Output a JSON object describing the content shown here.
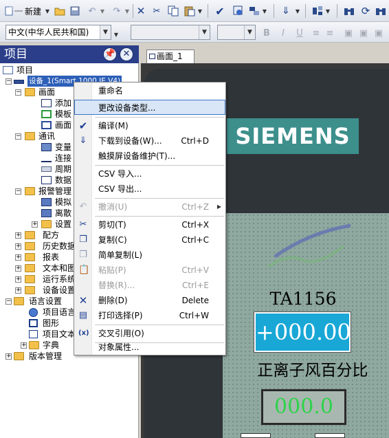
{
  "toolbar": {
    "new_label": "新建",
    "language_select": "中文(中华人民共和国)"
  },
  "left_pane": {
    "title": "项目",
    "tree": [
      {
        "label": "项目"
      },
      {
        "label": "设备_1(Smart 1000 IE V4)"
      },
      {
        "label": "画面"
      },
      {
        "label": "添加"
      },
      {
        "label": "模板"
      },
      {
        "label": "画面"
      },
      {
        "label": "通讯"
      },
      {
        "label": "变量"
      },
      {
        "label": "连接"
      },
      {
        "label": "周期"
      },
      {
        "label": "数据"
      },
      {
        "label": "报警管理"
      },
      {
        "label": "模拟"
      },
      {
        "label": "离散"
      },
      {
        "label": "设置"
      },
      {
        "label": "配方"
      },
      {
        "label": "历史数据"
      },
      {
        "label": "报表"
      },
      {
        "label": "文本和图"
      },
      {
        "label": "运行系统"
      },
      {
        "label": "设备设置"
      },
      {
        "label": "语言设置"
      },
      {
        "label": "项目语言"
      },
      {
        "label": "图形"
      },
      {
        "label": "项目文本"
      },
      {
        "label": "字典"
      },
      {
        "label": "版本管理"
      }
    ]
  },
  "editor": {
    "tab_label": "画面_1",
    "brand": "SIEMENS",
    "title_text": "TA1156",
    "value_display": "+000.00",
    "caption": "正离子风百分比",
    "value_display2": "000.0"
  },
  "context_menu": {
    "items": [
      {
        "label": "重命名",
        "shortcut": ""
      },
      {
        "label": "更改设备类型...",
        "shortcut": ""
      },
      {
        "label": "编译(M)",
        "shortcut": ""
      },
      {
        "label": "下载到设备(W)...",
        "shortcut": "Ctrl+D"
      },
      {
        "label": "触摸屏设备维护(T)...",
        "shortcut": ""
      },
      {
        "label": "CSV 导入...",
        "shortcut": ""
      },
      {
        "label": "CSV 导出...",
        "shortcut": ""
      },
      {
        "label": "撤消(U)",
        "shortcut": "Ctrl+Z"
      },
      {
        "label": "剪切(T)",
        "shortcut": "Ctrl+X"
      },
      {
        "label": "复制(C)",
        "shortcut": "Ctrl+C"
      },
      {
        "label": "简单复制(L)",
        "shortcut": ""
      },
      {
        "label": "粘贴(P)",
        "shortcut": "Ctrl+V"
      },
      {
        "label": "替换(R)...",
        "shortcut": "Ctrl+E"
      },
      {
        "label": "删除(D)",
        "shortcut": "Delete"
      },
      {
        "label": "打印选择(P)",
        "shortcut": "Ctrl+W"
      },
      {
        "label": "交叉引用(O)",
        "shortcut": ""
      },
      {
        "label": "对象属性...",
        "shortcut": ""
      }
    ]
  },
  "colors": {
    "tree_selected": "#2c5fb8",
    "value_box": "#19a7d6",
    "value_text2": "#2fd24a",
    "siemens_bg": "#3d8f8c"
  }
}
